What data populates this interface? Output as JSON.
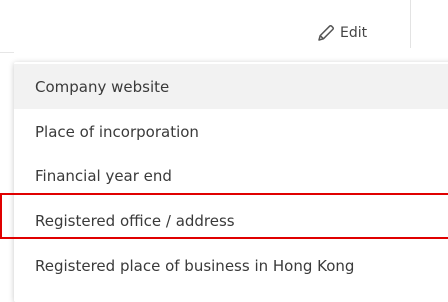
{
  "toolbar": {
    "edit_label": "Edit",
    "edit_icon": "pencil-icon"
  },
  "menu": {
    "items": [
      {
        "label": "Company website",
        "active": true
      },
      {
        "label": "Place of incorporation",
        "active": false
      },
      {
        "label": "Financial year end",
        "active": false
      },
      {
        "label": "Registered office / address",
        "active": false,
        "highlighted": true
      },
      {
        "label": "Registered place of business in Hong Kong",
        "active": false
      }
    ]
  },
  "colors": {
    "highlight": "#e00000",
    "active_item_bg": "#f2f2f2",
    "text": "#3a3a3a"
  }
}
